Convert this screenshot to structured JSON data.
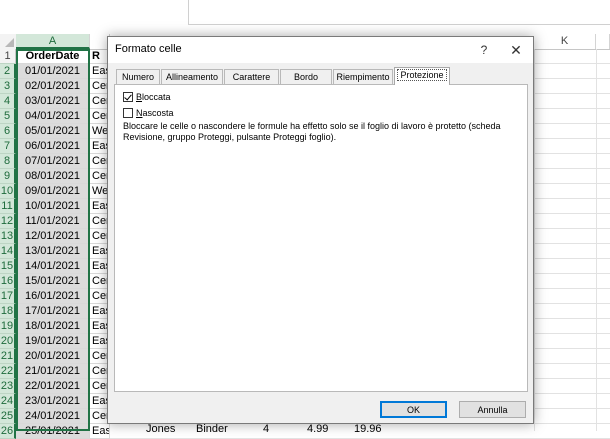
{
  "spreadsheet": {
    "columns": [
      "A",
      "K"
    ],
    "rows": [
      "1",
      "2",
      "3",
      "4",
      "5",
      "6",
      "7",
      "8",
      "9",
      "10",
      "11",
      "12",
      "13",
      "14",
      "15",
      "16",
      "17",
      "18",
      "19",
      "20",
      "21",
      "22",
      "23",
      "24",
      "25",
      "26"
    ],
    "header_a": "OrderDate",
    "header_b": "R",
    "dates": [
      "01/01/2021",
      "02/01/2021",
      "03/01/2021",
      "04/01/2021",
      "05/01/2021",
      "06/01/2021",
      "07/01/2021",
      "08/01/2021",
      "09/01/2021",
      "10/01/2021",
      "11/01/2021",
      "12/01/2021",
      "13/01/2021",
      "14/01/2021",
      "15/01/2021",
      "16/01/2021",
      "17/01/2021",
      "18/01/2021",
      "19/01/2021",
      "20/01/2021",
      "21/01/2021",
      "22/01/2021",
      "23/01/2021",
      "24/01/2021",
      "25/01/2021"
    ],
    "regions": [
      "Eas",
      "Cen",
      "Cen",
      "Cen",
      "We",
      "Eas",
      "Cen",
      "Cen",
      "We",
      "Eas",
      "Cen",
      "Cen",
      "Eas",
      "Eas",
      "Cen",
      "Cen",
      "Eas",
      "Eas",
      "Eas",
      "Cen",
      "Cen",
      "Cen",
      "Eas",
      "Cen",
      "East"
    ],
    "last_row": {
      "rep": "Jones",
      "item": "Binder",
      "units": "4",
      "unit_cost": "4.99",
      "total": "19.96"
    }
  },
  "dialog": {
    "title": "Formato celle",
    "help_symbol": "?",
    "close_symbol": "✕",
    "tabs": [
      {
        "label": "Numero",
        "active": false
      },
      {
        "label": "Allineamento",
        "active": false
      },
      {
        "label": "Carattere",
        "active": false
      },
      {
        "label": "Bordo",
        "active": false
      },
      {
        "label": "Riempimento",
        "active": false
      },
      {
        "label": "Protezione",
        "active": true
      }
    ],
    "locked": {
      "label_first": "B",
      "label_rest": "loccata",
      "checked": true
    },
    "hidden": {
      "label_first": "N",
      "label_rest": "ascosta",
      "checked": false
    },
    "description": "Bloccare le celle o nascondere le formule ha effetto solo se il foglio di lavoro è protetto (scheda Revisione, gruppo Proteggi, pulsante Proteggi foglio).",
    "ok_label": "OK",
    "cancel_label": "Annulla"
  },
  "colors": {
    "excel_green": "#217346",
    "selected_header": "#d3e7d9",
    "focus_blue": "#0078d7"
  }
}
